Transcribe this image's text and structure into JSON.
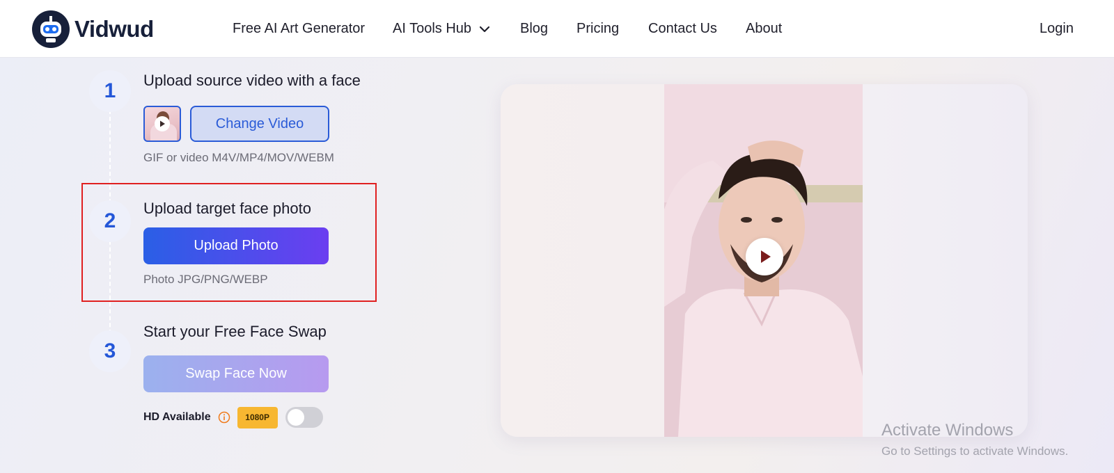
{
  "brand": {
    "name": "Vidwud"
  },
  "nav": {
    "items": [
      {
        "label": "Free AI Art Generator"
      },
      {
        "label": "AI Tools Hub"
      },
      {
        "label": "Blog"
      },
      {
        "label": "Pricing"
      },
      {
        "label": "Contact Us"
      },
      {
        "label": "About"
      }
    ],
    "login": "Login"
  },
  "steps": [
    {
      "number": "1",
      "title": "Upload source video with a face",
      "button": "Change Video",
      "hint": "GIF or video M4V/MP4/MOV/WEBM"
    },
    {
      "number": "2",
      "title": "Upload target face photo",
      "button": "Upload Photo",
      "hint": "Photo JPG/PNG/WEBP"
    },
    {
      "number": "3",
      "title": "Start your Free Face Swap",
      "button": "Swap Face Now"
    }
  ],
  "hd": {
    "label": "HD Available",
    "badge": "1080P",
    "enabled": false
  },
  "watermark": {
    "title": "Activate Windows",
    "subtitle": "Go to Settings to activate Windows."
  },
  "colors": {
    "accent": "#2a5bd7",
    "upload_gradient": [
      "#2a5fe6",
      "#6b3ef0"
    ],
    "swap_gradient": [
      "#9bb1ee",
      "#b79aef"
    ],
    "badge": "#f7b731",
    "highlight": "#e02020"
  },
  "icons": [
    "robot-logo-icon",
    "chevron-down-icon",
    "play-icon",
    "info-icon"
  ]
}
